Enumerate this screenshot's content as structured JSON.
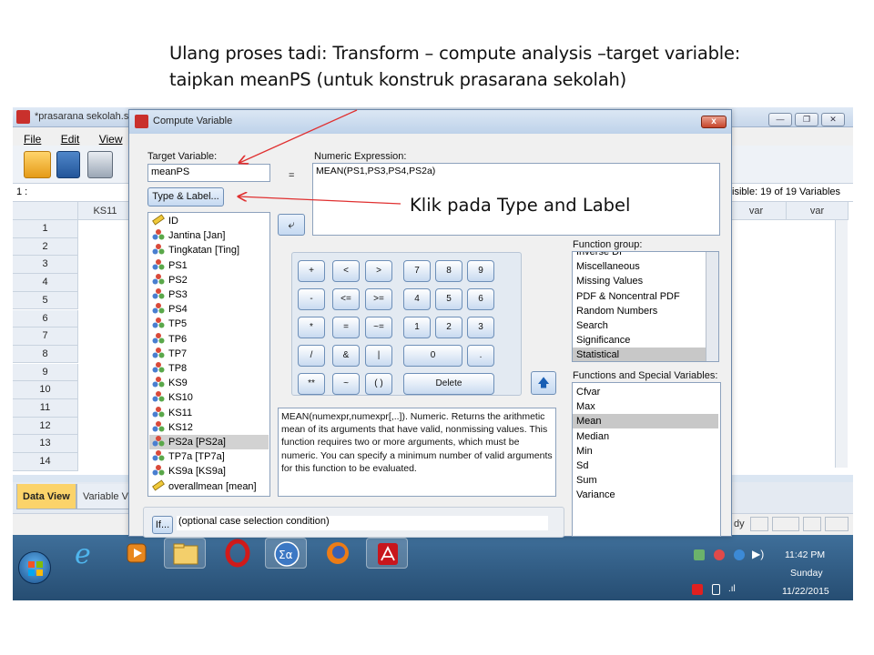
{
  "slide": {
    "line1": "Ulang proses tadi: Transform – compute analysis –target variable:",
    "line2": "taipkan meanPS (untuk konstruk prasarana sekolah)",
    "annotation": "Klik pada Type and Label"
  },
  "spss": {
    "title": "*prasarana sekolah.sav",
    "menu": [
      "File",
      "Edit",
      "View",
      "Da"
    ],
    "cell_ref": "1 :",
    "visible": "isible: 19 of 19 Variables",
    "columns": [
      "KS11",
      "var",
      "var"
    ],
    "rows": [
      "1",
      "2",
      "3",
      "4",
      "5",
      "6",
      "7",
      "8",
      "9",
      "10",
      "11",
      "12",
      "13",
      "14"
    ],
    "tabs": [
      "Data View",
      "Variable Vi"
    ],
    "status_fragment": "dy"
  },
  "dialog": {
    "title": "Compute Variable",
    "close": "x",
    "target_label": "Target Variable:",
    "target_value": "meanPS",
    "equals": "=",
    "expr_label": "Numeric Expression:",
    "expr_value": "MEAN(PS1,PS3,PS4,PS2a)",
    "type_label_button": "Type & Label...",
    "variables": [
      {
        "name": "ID",
        "icon": "ruler"
      },
      {
        "name": "Jantina [Jan]",
        "icon": "nominal"
      },
      {
        "name": "Tingkatan [Ting]",
        "icon": "nominal"
      },
      {
        "name": "PS1",
        "icon": "nominal"
      },
      {
        "name": "PS2",
        "icon": "nominal"
      },
      {
        "name": "PS3",
        "icon": "nominal"
      },
      {
        "name": "PS4",
        "icon": "nominal"
      },
      {
        "name": "TP5",
        "icon": "nominal"
      },
      {
        "name": "TP6",
        "icon": "nominal"
      },
      {
        "name": "TP7",
        "icon": "nominal"
      },
      {
        "name": "TP8",
        "icon": "nominal"
      },
      {
        "name": "KS9",
        "icon": "nominal"
      },
      {
        "name": "KS10",
        "icon": "nominal"
      },
      {
        "name": "KS11",
        "icon": "nominal"
      },
      {
        "name": "KS12",
        "icon": "nominal"
      },
      {
        "name": "PS2a [PS2a]",
        "icon": "nominal",
        "selected": true
      },
      {
        "name": "TP7a [TP7a]",
        "icon": "nominal"
      },
      {
        "name": "KS9a [KS9a]",
        "icon": "nominal"
      },
      {
        "name": "overallmean [mean]",
        "icon": "ruler"
      }
    ],
    "keypad": [
      [
        "+",
        "<",
        ">",
        "7",
        "8",
        "9"
      ],
      [
        "-",
        "<=",
        ">=",
        "4",
        "5",
        "6"
      ],
      [
        "*",
        "=",
        "~=",
        "1",
        "2",
        "3"
      ],
      [
        "/",
        "&",
        "|",
        "0",
        "."
      ],
      [
        "**",
        "~",
        "( )",
        "Delete"
      ]
    ],
    "function_group_label": "Function group:",
    "function_groups": [
      "Inverse DF",
      "Miscellaneous",
      "Missing Values",
      "PDF & Noncentral PDF",
      "Random Numbers",
      "Search",
      "Significance",
      "Statistical"
    ],
    "function_group_selected": "Statistical",
    "functions_label": "Functions and Special Variables:",
    "functions": [
      "Cfvar",
      "Max",
      "Mean",
      "Median",
      "Min",
      "Sd",
      "Sum",
      "Variance"
    ],
    "function_selected": "Mean",
    "description": "MEAN(numexpr,numexpr[,..]). Numeric. Returns the arithmetic mean of its arguments that have valid, nonmissing values. This function requires two or more arguments, which must be numeric. You can specify a minimum number of valid arguments for this function to be evaluated.",
    "if_button": "If...",
    "if_text": "(optional case selection condition)"
  },
  "tray": {
    "time": "11:42 PM",
    "day": "Sunday",
    "date": "11/22/2015"
  },
  "colors": {
    "arrow": "#e03030",
    "accent": "#2d67b6"
  }
}
